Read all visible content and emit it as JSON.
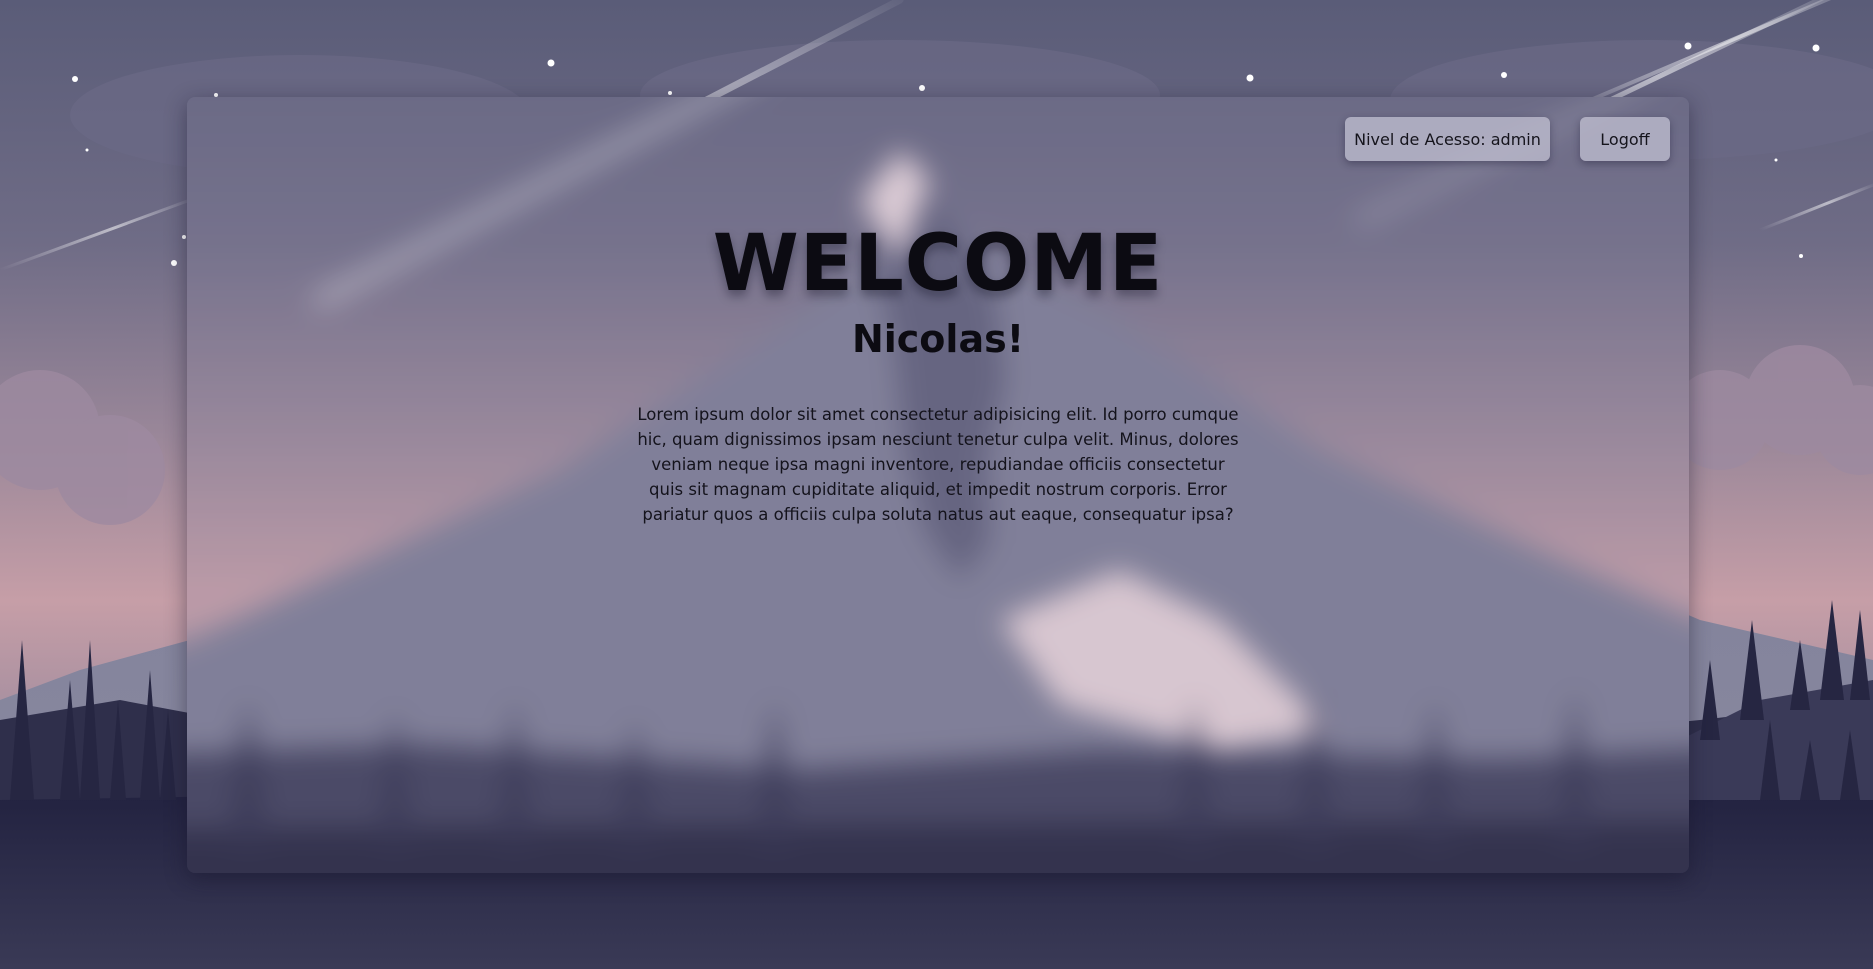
{
  "header": {
    "access_level_label": "Nivel de Acesso: admin",
    "logoff_label": "Logoff"
  },
  "main": {
    "title": "WELCOME",
    "subtitle": "Nicolas!",
    "paragraph": "Lorem ipsum dolor sit amet consectetur adipisicing elit. Id porro cumque hic, quam dignissimos ipsam nesciunt tenetur culpa velit. Minus, dolores veniam neque ipsa magni inventore, repudiandae officiis consectetur quis sit magnam cupiditate aliquid, et impedit nostrum corporis. Error pariatur quos a officiis culpa soluta natus aut eaque, consequatur ipsa?"
  },
  "colors": {
    "sky_top": "#5b5d79",
    "sky_mid": "#8c7f95",
    "sky_horizon": "#c9a0a8",
    "ground": "#1d1d36",
    "button_bg": "#bebcce",
    "text": "#0c0b12"
  }
}
